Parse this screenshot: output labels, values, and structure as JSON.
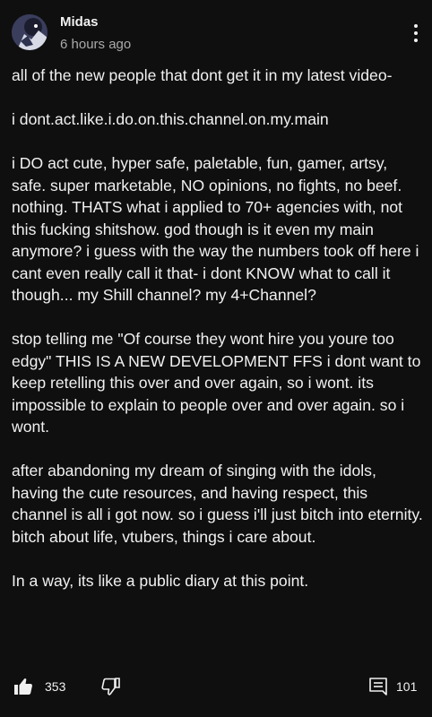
{
  "post": {
    "author": "Midas",
    "timestamp": "6 hours ago",
    "paragraphs": [
      "all of the new people that dont get it in my latest video-",
      "i dont.act.like.i.do.on.this.channel.on.my.main",
      "i DO act cute, hyper safe, paletable, fun, gamer, artsy, safe. super marketable, NO opinions, no fights, no beef. nothing. THATS what i applied to 70+ agencies with, not this fucking shitshow. god though is it even my main anymore? i guess with the way the numbers took off here i cant even really call it that- i dont KNOW what to call it though... my Shill channel? my 4+Channel?",
      "stop telling me \"Of course they wont hire you youre too edgy\" THIS IS A NEW DEVELOPMENT FFS i dont want to keep retelling this over and over again, so i wont. its impossible to explain to people over and over again. so i wont.",
      "after abandoning my dream of singing with the idols, having the cute resources, and having respect, this channel is all i got now. so i guess i'll just bitch into eternity. bitch about life, vtubers, things i care about.",
      "In a way, its like a public diary at this point."
    ]
  },
  "actions": {
    "like_count": "353",
    "comment_count": "101"
  },
  "icons": {
    "avatar": "avatar",
    "menu": "more-vert-icon",
    "like": "thumbs-up-icon",
    "dislike": "thumbs-down-icon",
    "comment": "comment-icon"
  },
  "colors": {
    "background": "#0f0f0f",
    "text": "#f1f1f1",
    "secondary_text": "#aaaaaa"
  }
}
